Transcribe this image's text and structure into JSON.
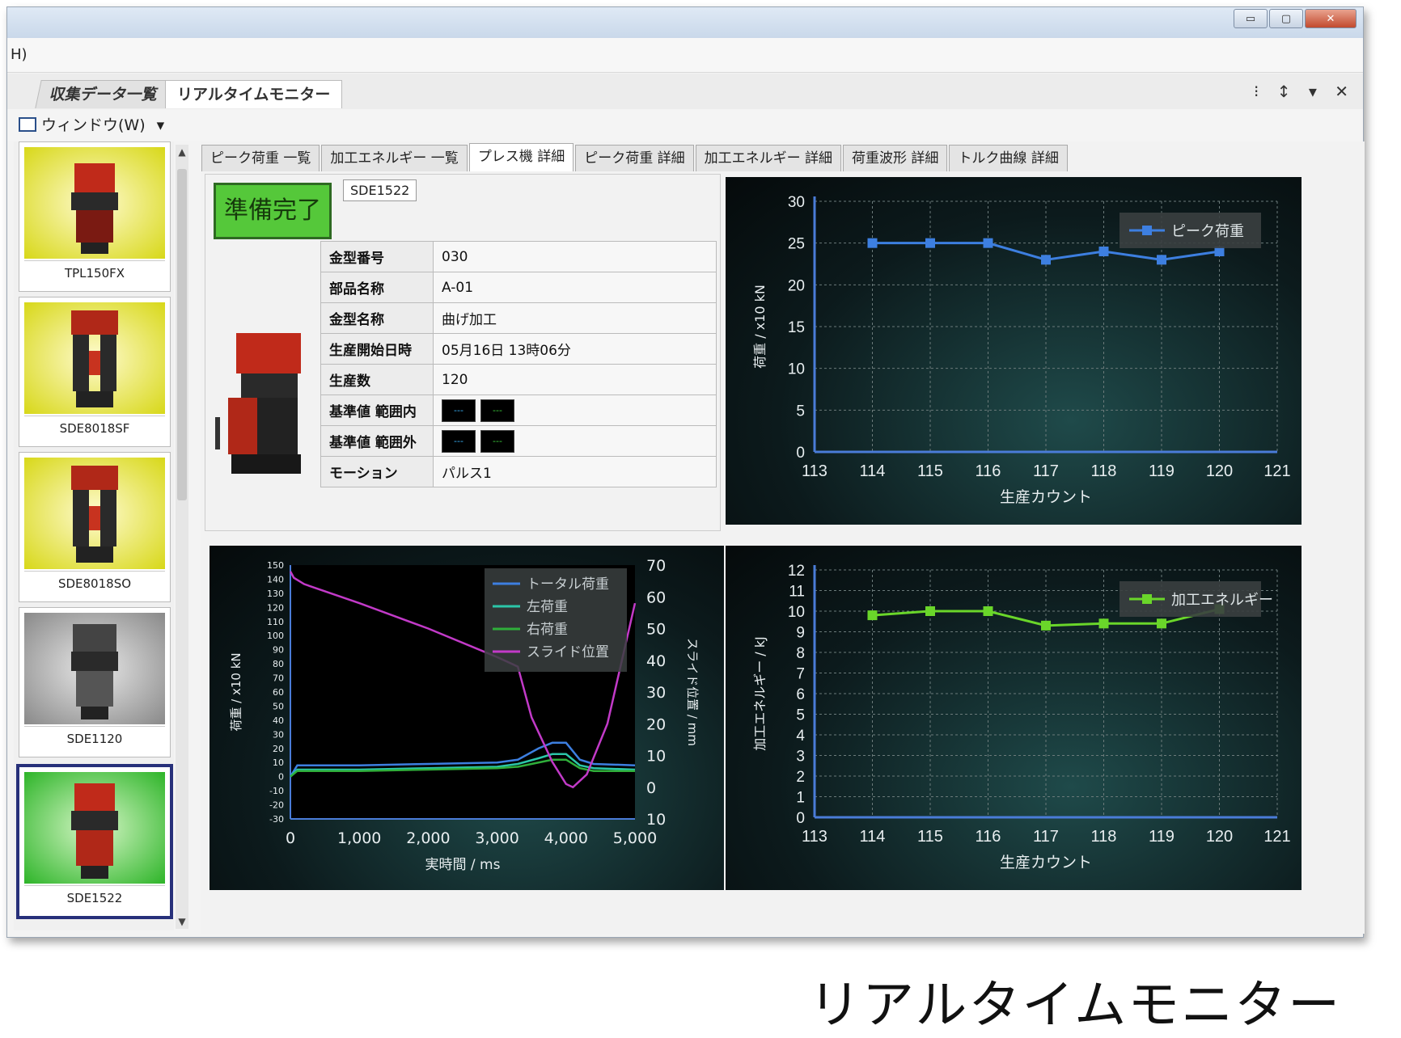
{
  "window": {
    "menu_partial": "H)",
    "min": "▭",
    "max": "▢",
    "close": "✕"
  },
  "doc_tabs": [
    "収集データ一覧",
    "リアルタイムモニター"
  ],
  "doc_tab_controls": "⁝ ↕ ▾ ✕",
  "toolbar": {
    "window_menu": "ウィンドウ(W)",
    "caret": "▾"
  },
  "machines": [
    {
      "name": "TPL150FX",
      "bg": "yellow"
    },
    {
      "name": "SDE8018SF",
      "bg": "yellow"
    },
    {
      "name": "SDE8018SO",
      "bg": "yellow"
    },
    {
      "name": "SDE1120",
      "bg": "gray"
    },
    {
      "name": "SDE1522",
      "bg": "green",
      "selected": true
    }
  ],
  "sub_tabs": [
    "ピーク荷重 一覧",
    "加工エネルギー 一覧",
    "プレス機 詳細",
    "ピーク荷重 詳細",
    "加工エネルギー 詳細",
    "荷重波形 詳細",
    "トルク曲線 詳細"
  ],
  "active_sub_tab": 2,
  "status": {
    "label": "準備完了",
    "machine_id": "SDE1522"
  },
  "info": {
    "rows": [
      {
        "k": "金型番号",
        "v": "030"
      },
      {
        "k": "部品名称",
        "v": "A-01"
      },
      {
        "k": "金型名称",
        "v": "曲げ加工"
      },
      {
        "k": "生産開始日時",
        "v": "05月16日 13時06分"
      },
      {
        "k": "生産数",
        "v": "120"
      }
    ],
    "std_in": "基準値 範囲内",
    "std_out": "基準値 範囲外",
    "motion_k": "モーション",
    "motion_v": "パルス1",
    "lamp_text": "---"
  },
  "colors": {
    "ready": "#55c83a",
    "blue": "#3d7fe0",
    "green": "#6ad62a",
    "teal": "#2bc6a8",
    "mgreen": "#2fae3a",
    "magenta": "#c23ac8"
  },
  "chart_data": [
    {
      "type": "line",
      "title": "",
      "xlabel": "生産カウント",
      "ylabel": "荷重 / x10 kN",
      "x": [
        114,
        115,
        116,
        117,
        118,
        119,
        120
      ],
      "series": [
        {
          "name": "ピーク荷重",
          "values": [
            25,
            25,
            25,
            23,
            24,
            23,
            24
          ]
        }
      ],
      "xlim": [
        113,
        121
      ],
      "ylim": [
        0,
        30
      ],
      "yticks": [
        0,
        5,
        10,
        15,
        20,
        25,
        30
      ],
      "legend": "top-right",
      "grid": true
    },
    {
      "type": "line",
      "title": "",
      "xlabel": "生産カウント",
      "ylabel": "加工エネルギー / kJ",
      "x": [
        114,
        115,
        116,
        117,
        118,
        119,
        120
      ],
      "series": [
        {
          "name": "加工エネルギー",
          "values": [
            9.8,
            10.0,
            10.0,
            9.3,
            9.4,
            9.4,
            10.1
          ]
        }
      ],
      "xlim": [
        113,
        121
      ],
      "ylim": [
        0,
        12
      ],
      "yticks": [
        0,
        1,
        2,
        3,
        4,
        5,
        6,
        7,
        8,
        9,
        10,
        11,
        12
      ],
      "legend": "top-right",
      "grid": true
    },
    {
      "type": "line",
      "title": "",
      "xlabel": "実時間 / ms",
      "ylabel": "荷重 / x10 kN",
      "y2label": "スライド位置 / mm",
      "xlim": [
        0,
        5000
      ],
      "ylim": [
        -30,
        150
      ],
      "y2lim": [
        -10,
        70
      ],
      "xticks": [
        0,
        1000,
        2000,
        3000,
        4000,
        5000
      ],
      "xticklabels": [
        "0",
        "1,000",
        "2,000",
        "3,000",
        "4,000",
        "5,000"
      ],
      "yticks": [
        -30,
        -20,
        -10,
        0,
        10,
        20,
        30,
        40,
        50,
        60,
        70,
        80,
        90,
        100,
        110,
        120,
        130,
        140,
        150
      ],
      "y2ticks": [
        70,
        60,
        50,
        40,
        30,
        20,
        10,
        0,
        10
      ],
      "legend": "top-right",
      "grid": false,
      "series": [
        {
          "name": "トータル荷重",
          "axis": "left",
          "x": [
            0,
            100,
            1000,
            2000,
            3000,
            3300,
            3600,
            3800,
            4000,
            4200,
            4400,
            5000
          ],
          "values": [
            0,
            8,
            8,
            9,
            10,
            12,
            20,
            24,
            24,
            12,
            9,
            8
          ]
        },
        {
          "name": "左荷重",
          "axis": "left",
          "x": [
            0,
            100,
            1000,
            2000,
            3000,
            3300,
            3600,
            3800,
            4000,
            4200,
            4400,
            5000
          ],
          "values": [
            0,
            5,
            5,
            6,
            7,
            9,
            13,
            16,
            16,
            8,
            6,
            5
          ]
        },
        {
          "name": "右荷重",
          "axis": "left",
          "x": [
            0,
            100,
            1000,
            2000,
            3000,
            3300,
            3600,
            3800,
            4000,
            4200,
            4400,
            5000
          ],
          "values": [
            0,
            4,
            4,
            5,
            6,
            7,
            10,
            12,
            12,
            6,
            4,
            4
          ]
        },
        {
          "name": "スライド位置",
          "axis": "right",
          "x": [
            0,
            50,
            200,
            1000,
            2000,
            3000,
            3300,
            3500,
            3800,
            4000,
            4100,
            4300,
            4600,
            5000
          ],
          "values": [
            68,
            66,
            64,
            58,
            50,
            41,
            38,
            22,
            8,
            1,
            0,
            4,
            20,
            58
          ]
        }
      ]
    }
  ],
  "caption": "リアルタイムモニター"
}
